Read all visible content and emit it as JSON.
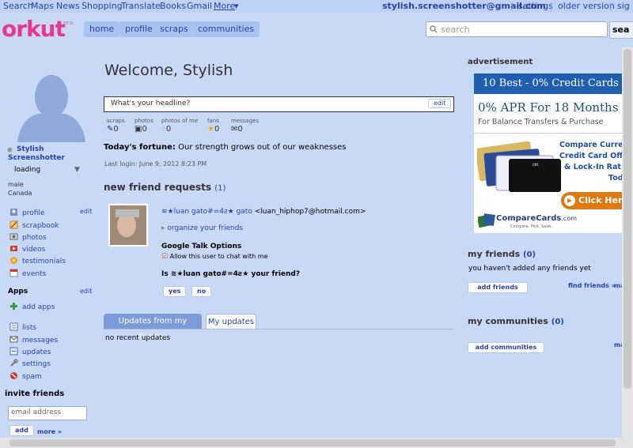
{
  "topbar": {
    "links": [
      "Search",
      "Maps",
      "News",
      "Shopping",
      "Translate",
      "Books",
      "Gmail"
    ],
    "more": "More",
    "more_arrow": "▾",
    "account_email": "stylish.screenshotter@gmail.com",
    "settings": "settings",
    "older_version": "older version",
    "signout": "sig"
  },
  "header": {
    "logo": "orkut",
    "beta": "BETA",
    "nav": [
      "home",
      "profile",
      "scraps",
      "communities"
    ],
    "search_placeholder": "search",
    "search_button": "sea"
  },
  "sidebar": {
    "name_line1": "Stylish",
    "name_line2": "Screenshotter",
    "status": "loading",
    "gender": "male",
    "country": "Canada",
    "edit": "edit",
    "profile_items": [
      "profile",
      "scrapbook",
      "photos",
      "videos",
      "testimonials",
      "events"
    ],
    "apps_heading": "Apps",
    "apps_edit": "edit",
    "add_apps": "add apps",
    "tool_items": [
      "lists",
      "messages",
      "updates",
      "settings",
      "spam"
    ],
    "invite_heading": "invite friends",
    "email_placeholder": "email address",
    "add_button": "add",
    "more_link": "more »"
  },
  "main": {
    "welcome": "Welcome, Stylish",
    "headline_placeholder": "What's your headline?",
    "headline_edit": "edit",
    "stats": [
      {
        "label": "scraps",
        "value": "0"
      },
      {
        "label": "photos",
        "value": "0"
      },
      {
        "label": "photos of me",
        "value": "0"
      },
      {
        "label": "fans",
        "value": "0"
      },
      {
        "label": "messages",
        "value": "0"
      }
    ],
    "fortune_label": "Today's fortune:",
    "fortune_text": "Our strength grows out of our weaknesses",
    "last_login": "Last login: June 9, 2012 8:23 PM",
    "requests_heading": "new friend requests",
    "requests_count": "(1)",
    "request_name": "≋★luan gato#=4ƨ★ gato",
    "request_email": "<luan_hiphop7@hotmail.com>",
    "organize": "organize your friends",
    "gtalk_heading": "Google Talk Options",
    "gtalk_allow": "Allow this user to chat with me",
    "friend_question": "Is ≋★luan gato#=4ƨ★ your friend?",
    "yes": "yes",
    "no": "no",
    "tab_friends": "Updates from my friends",
    "tab_mine": "My updates",
    "no_updates": "no recent updates"
  },
  "right": {
    "ad_heading": "advertisement",
    "ad_banner": "10 Best - 0% Credit Cards",
    "ad_apr": "0% APR For 18 Months",
    "ad_balance": "For Balance Transfers & Purchase",
    "ad_compare1": "Compare Curre",
    "ad_compare2": "Credit Card Offe",
    "ad_compare3": "& Lock-In Rat",
    "ad_compare4": "Toda",
    "ad_click": "Click Here",
    "ad_brand": "CompareCards",
    "ad_brand_suffix": ".com",
    "ad_tagline": "Compare. Pick. Save.",
    "friends_heading": "my friends",
    "friends_count": "(0)",
    "friends_none": "you haven't added any friends yet",
    "add_friends": "add friends",
    "find_friends": "find friends »",
    "friends_more": "ma",
    "communities_heading": "my communities",
    "communities_count": "(0)",
    "add_communities": "add communities",
    "communities_more": "ma"
  }
}
